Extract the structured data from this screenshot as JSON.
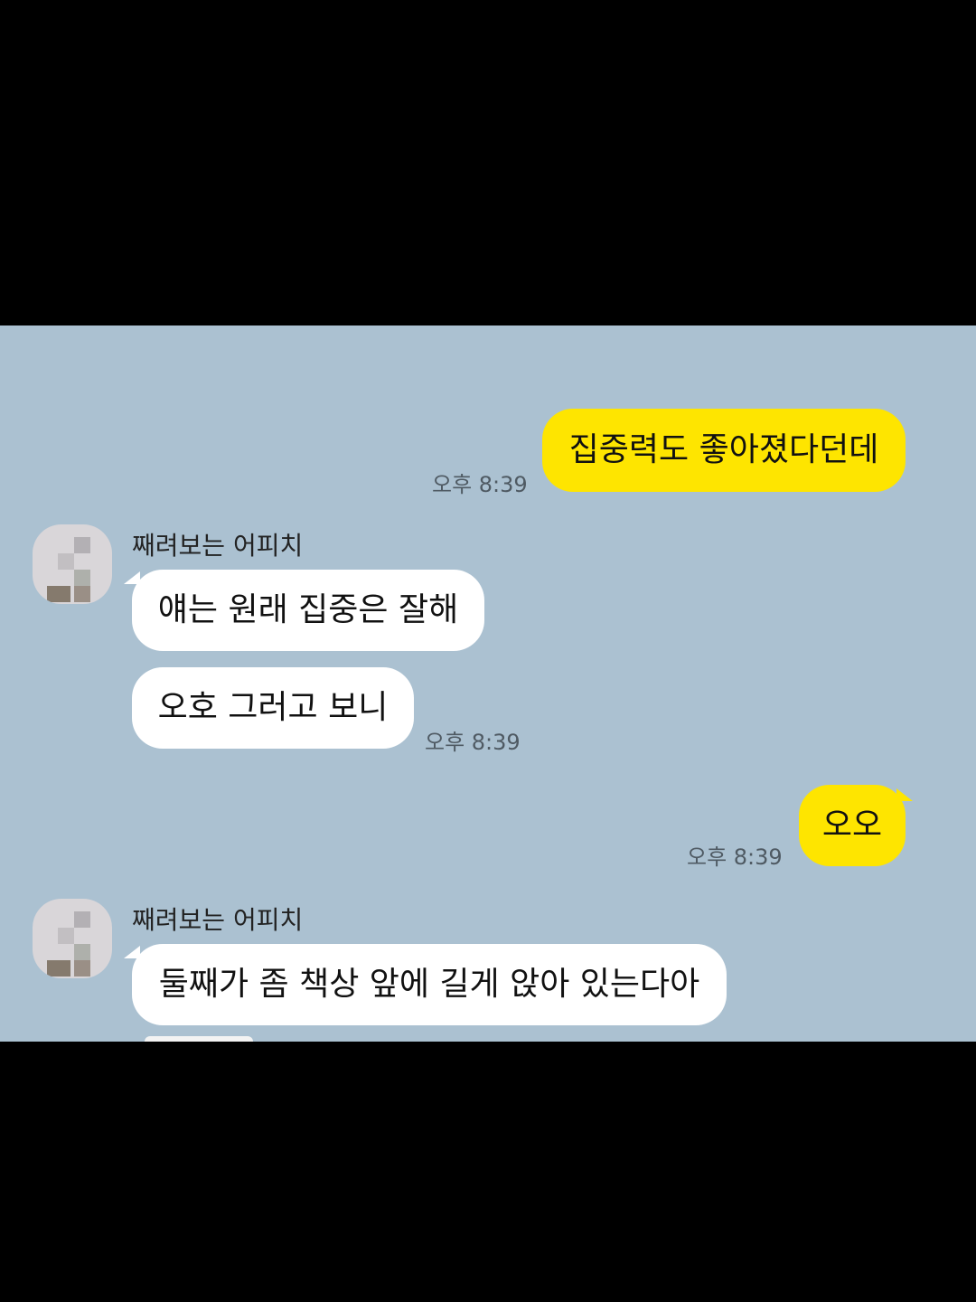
{
  "messages": [
    {
      "from": "me",
      "text": "집중력도 좋아졌다던데",
      "time": "오후 8:39"
    },
    {
      "from": "them",
      "sender": "째려보는 어피치",
      "text": "얘는 원래 집중은 잘해"
    },
    {
      "from": "them",
      "text": "오호 그러고 보니",
      "time": "오후 8:39"
    },
    {
      "from": "me",
      "text": "오오",
      "time": "오후 8:39"
    },
    {
      "from": "them",
      "sender": "째려보는 어피치",
      "text": "둘째가 좀 책상 앞에 길게 앉아 있는다아"
    }
  ],
  "colors": {
    "background": "#abc1d1",
    "my_bubble": "#fee500",
    "their_bubble": "#ffffff",
    "letterbox": "#000000"
  }
}
